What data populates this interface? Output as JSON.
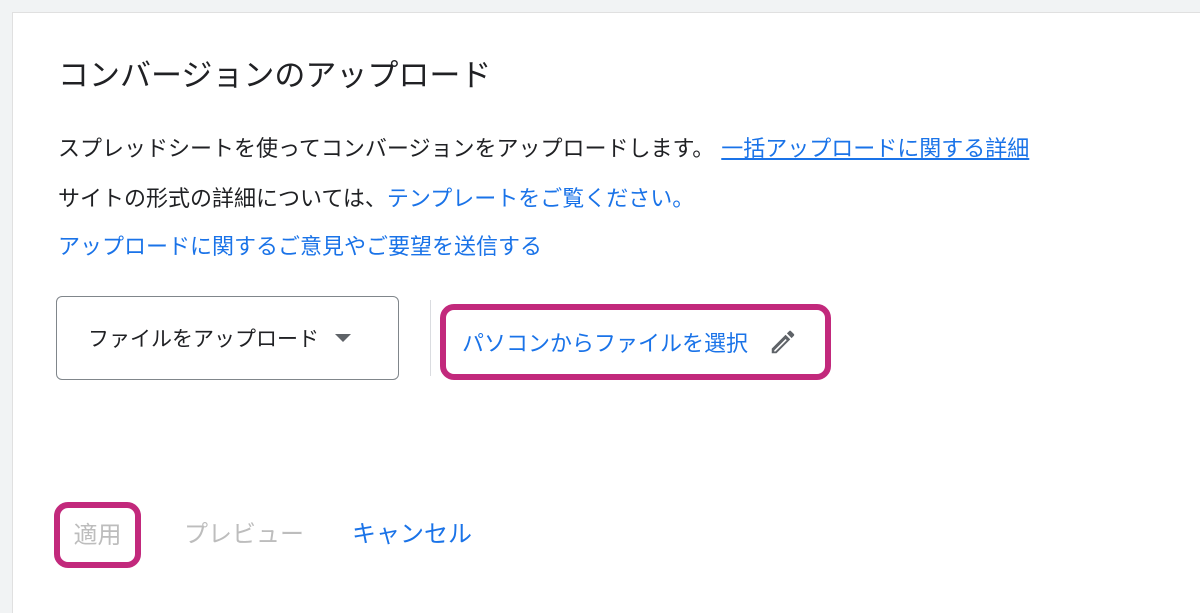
{
  "dialog": {
    "title": "コンバージョンのアップロード",
    "line1_text": "スプレッドシートを使ってコンバージョンをアップロードします。",
    "line1_link": "一括アップロードに関する詳細",
    "line2_text": "サイトの形式の詳細については、",
    "line2_link": "テンプレートをご覧ください。",
    "feedback_link": "アップロードに関するご意見やご要望を送信する"
  },
  "upload": {
    "source_dropdown_label": "ファイルをアップロード",
    "choose_file_label": "パソコンからファイルを選択"
  },
  "actions": {
    "apply_label": "適用",
    "preview_label": "プレビュー",
    "cancel_label": "キャンセル"
  },
  "colors": {
    "link": "#1a73e8",
    "highlight": "#c2297c",
    "disabled_text": "#bdbdbd"
  },
  "icons": {
    "dropdown": "triangle-down",
    "edit": "pencil"
  }
}
